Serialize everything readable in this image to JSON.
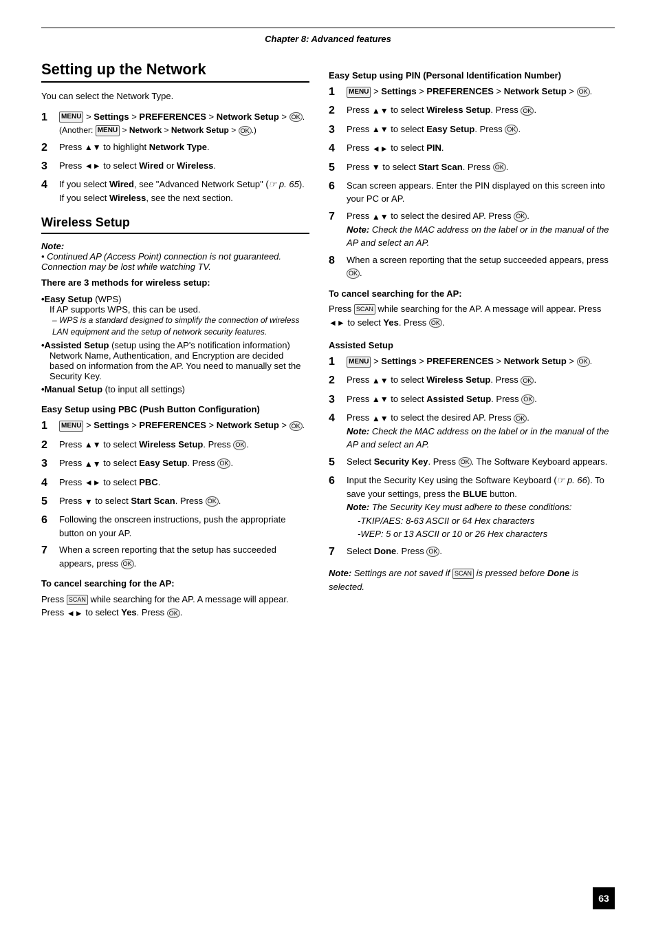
{
  "chapter_header": "Chapter 8: Advanced features",
  "page_number": "63",
  "left_col": {
    "main_title": "Setting up the Network",
    "intro": "You can select the Network Type.",
    "main_steps": [
      {
        "num": "1",
        "content": "MENU > Settings > PREFERENCES > Network Setup > OK.",
        "sub": "(Another: MENU > Network > Network Setup > OK.)"
      },
      {
        "num": "2",
        "content": "Press ▲ or ▼ to highlight Network Type."
      },
      {
        "num": "3",
        "content": "Press ◄ or ► to select Wired or Wireless."
      },
      {
        "num": "4",
        "content": "If you select Wired, see \"Advanced Network Setup\" (☞ p. 65).",
        "sub2": "If you select Wireless, see the next section."
      }
    ],
    "wireless_title": "Wireless Setup",
    "note_label": "Note:",
    "note_italic": "Continued AP (Access Point) connection is not guaranteed. Connection may be lost while watching TV.",
    "methods_intro": "There are 3 methods for wireless setup:",
    "methods": [
      {
        "label": "•Easy Setup",
        "suffix": " (WPS)",
        "desc": "If AP supports WPS, this can be used.",
        "sub": "– WPS is a standard designed to simplify the connection of wireless LAN equipment and the setup of network security features."
      },
      {
        "label": "•Assisted Setup",
        "suffix": " (setup using the AP's notification information)",
        "desc": "Network Name, Authentication, and Encryption are decided based on information from the AP. You need to manually set the Security Key."
      },
      {
        "label": "•Manual Setup",
        "suffix": " (to input all settings)"
      }
    ],
    "pbc_title": "Easy Setup using PBC (Push Button Configuration)",
    "pbc_steps": [
      {
        "num": "1",
        "content": "MENU > Settings > PREFERENCES > Network Setup > OK."
      },
      {
        "num": "2",
        "content": "Press ▲ or ▼ to select Wireless Setup. Press OK."
      },
      {
        "num": "3",
        "content": "Press ▲ or ▼ to select Easy Setup. Press OK."
      },
      {
        "num": "4",
        "content": "Press ◄ or ► to select PBC."
      },
      {
        "num": "5",
        "content": "Press ▼ to select Start Scan. Press OK."
      },
      {
        "num": "6",
        "content": "Following the onscreen instructions, push the appropriate button on your AP."
      },
      {
        "num": "7",
        "content": "When a screen reporting that the setup has succeeded appears, press OK."
      }
    ],
    "pbc_cancel_title": "To cancel searching for the AP:",
    "pbc_cancel_text": "Press SCAN while searching for the AP. A message will appear. Press ◄ or ► to select Yes. Press OK.",
    "cancel_label": "SCAN"
  },
  "right_col": {
    "pin_title": "Easy Setup using PIN (Personal Identification Number)",
    "pin_steps": [
      {
        "num": "1",
        "content": "MENU > Settings > PREFERENCES > Network Setup > OK."
      },
      {
        "num": "2",
        "content": "Press ▲ or ▼ to select Wireless Setup. Press OK."
      },
      {
        "num": "3",
        "content": "Press ▲ or ▼ to select Easy Setup. Press OK."
      },
      {
        "num": "4",
        "content": "Press ◄ or ► to select PIN."
      },
      {
        "num": "5",
        "content": "Press ▼ to select Start Scan. Press OK."
      },
      {
        "num": "6",
        "content": "Scan screen appears. Enter the PIN displayed on this screen into your PC or AP."
      },
      {
        "num": "7",
        "content": "Press ▲ or ▼ to select the desired AP. Press OK.",
        "note": "Note: Check the MAC address on the label or in the manual of the AP and select an AP."
      },
      {
        "num": "8",
        "content": "When a screen reporting that the setup succeeded appears, press OK."
      }
    ],
    "pin_cancel_title": "To cancel searching for the AP:",
    "pin_cancel_text": "Press SCAN while searching for the AP. A message will appear. Press ◄ or ► to select Yes. Press OK.",
    "assisted_title": "Assisted Setup",
    "assisted_steps": [
      {
        "num": "1",
        "content": "MENU > Settings > PREFERENCES > Network Setup > OK."
      },
      {
        "num": "2",
        "content": "Press ▲ or ▼ to select Wireless Setup. Press OK."
      },
      {
        "num": "3",
        "content": "Press ▲ or ▼ to select Assisted Setup. Press OK."
      },
      {
        "num": "4",
        "content": "Press ▲ or ▼ to select the desired AP. Press OK.",
        "note": "Note: Check the MAC address on the label or in the manual of the AP and select an AP."
      },
      {
        "num": "5",
        "content": "Select Security Key. Press OK. The Software Keyboard appears."
      },
      {
        "num": "6",
        "content": "Input the Security Key using the Software Keyboard (☞ p. 66). To save your settings, press the BLUE button.",
        "note": "Note: The Security Key must adhere to these conditions:\n-TKIP/AES: 8-63 ASCII or 64 Hex characters\n-WEP: 5 or 13 ASCII or 10 or 26 Hex characters"
      },
      {
        "num": "7",
        "content": "Select Done. Press OK."
      }
    ],
    "assisted_note": "Note: Settings are not saved if SCAN is pressed before Done is selected."
  }
}
